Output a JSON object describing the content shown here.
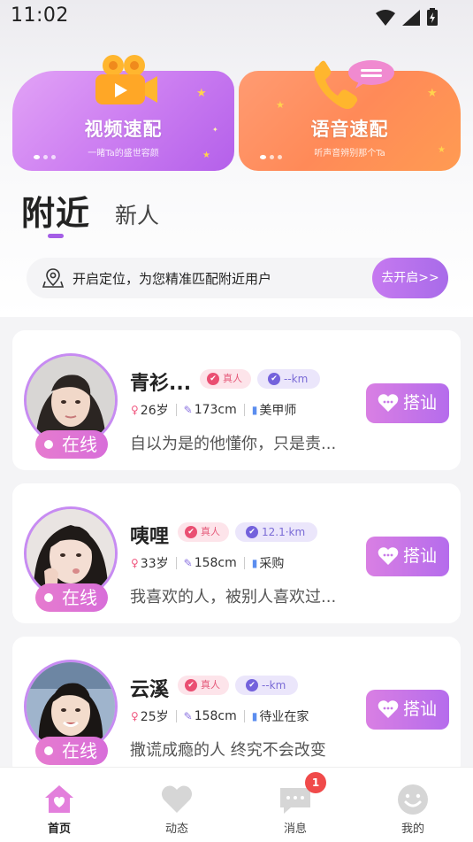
{
  "status_bar": {
    "time": "11:02"
  },
  "banners": {
    "video": {
      "title": "视频速配",
      "subtitle": "一睹Ta的盛世容颜",
      "icon": "video-camera-icon"
    },
    "voice": {
      "title": "语音速配",
      "subtitle": "听声音辨别那个Ta",
      "icon": "phone-icon"
    }
  },
  "tabs": [
    {
      "label": "附近",
      "active": true
    },
    {
      "label": "新人",
      "active": false
    }
  ],
  "location": {
    "text": "开启定位，为您精准匹配附近用户",
    "button": "去开启>>"
  },
  "users": [
    {
      "name": "青衫...",
      "real_tag": "真人",
      "distance": "--km",
      "age": "26岁",
      "height": "173cm",
      "job": "美甲师",
      "bio": "自以为是的他懂你，只是责...",
      "status": "在线",
      "action": "搭讪"
    },
    {
      "name": "咦哩",
      "real_tag": "真人",
      "distance": "12.1·km",
      "age": "33岁",
      "height": "158cm",
      "job": "采购",
      "bio": "我喜欢的人，被别人喜欢过...",
      "status": "在线",
      "action": "搭讪"
    },
    {
      "name": "云溪",
      "real_tag": "真人",
      "distance": "--km",
      "age": "25岁",
      "height": "158cm",
      "job": "待业在家",
      "bio": "撒谎成瘾的人 终究不会改变",
      "status": "在线",
      "action": "搭讪"
    }
  ],
  "nav": [
    {
      "label": "首页",
      "icon": "home-icon",
      "active": true
    },
    {
      "label": "动态",
      "icon": "heart-icon",
      "active": false
    },
    {
      "label": "消息",
      "icon": "message-icon",
      "active": false,
      "badge": "1"
    },
    {
      "label": "我的",
      "icon": "smiley-icon",
      "active": false
    }
  ],
  "colors": {
    "accent": "#a45ee6",
    "video_banner": "#cf82f2",
    "voice_banner": "#ff8a58",
    "online": "#d86ed9",
    "badge": "#f04a4a"
  }
}
